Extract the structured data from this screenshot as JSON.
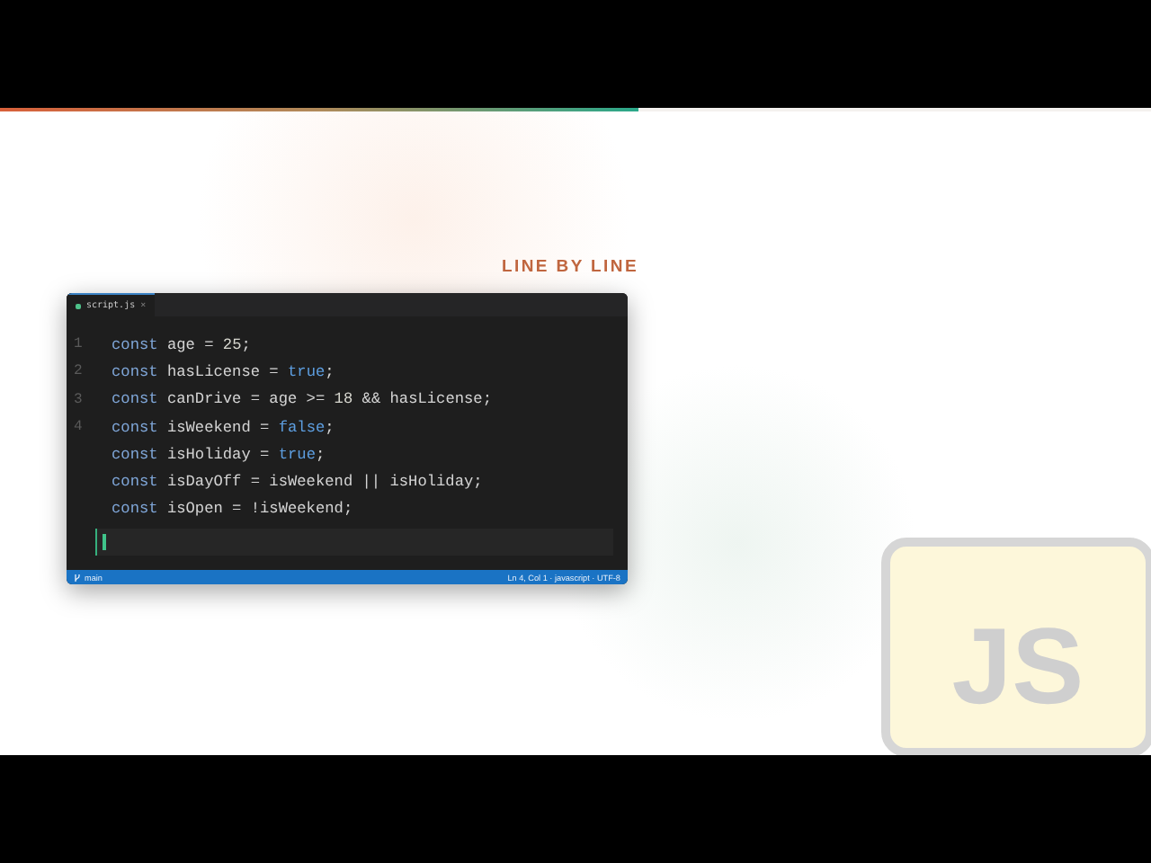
{
  "progress": {
    "level": 0.555
  },
  "heading": "LINE BY LINE",
  "editor": {
    "tab": {
      "label": "script.js",
      "close": "×",
      "selected": true
    },
    "lines": [
      {
        "number": "1",
        "tokens": [
          {
            "kind": "keyword",
            "text": "const"
          },
          {
            "kind": "plain",
            "text": " age = "
          },
          {
            "kind": "number",
            "text": "25"
          },
          {
            "kind": "plain",
            "text": ";"
          }
        ]
      },
      {
        "number": "2",
        "tokens": [
          {
            "kind": "keyword",
            "text": "const"
          },
          {
            "kind": "plain",
            "text": " hasLicense = "
          },
          {
            "kind": "literal",
            "text": "true"
          },
          {
            "kind": "plain",
            "text": ";"
          }
        ]
      },
      {
        "number": "3",
        "tokens": [
          {
            "kind": "keyword",
            "text": "const"
          },
          {
            "kind": "plain",
            "text": " canDrive = age >= "
          },
          {
            "kind": "number",
            "text": "18"
          },
          {
            "kind": "plain",
            "text": " && hasLicense;"
          }
        ]
      },
      {
        "number": "4",
        "tokens": [
          {
            "kind": "keyword",
            "text": "const"
          },
          {
            "kind": "plain",
            "text": " isWeekend = "
          },
          {
            "kind": "literal",
            "text": "false"
          },
          {
            "kind": "plain",
            "text": ";"
          }
        ]
      },
      {
        "tokens": [
          {
            "kind": "keyword",
            "text": "const"
          },
          {
            "kind": "plain",
            "text": " isHoliday = "
          },
          {
            "kind": "literal",
            "text": "true"
          },
          {
            "kind": "plain",
            "text": ";"
          }
        ]
      },
      {
        "tokens": [
          {
            "kind": "keyword",
            "text": "const"
          },
          {
            "kind": "plain",
            "text": " isDayOff = isWeekend || isHoliday;"
          }
        ]
      },
      {
        "tokens": [
          {
            "kind": "keyword",
            "text": "const"
          },
          {
            "kind": "plain",
            "text": " isOpen = !isWeekend;"
          }
        ]
      }
    ],
    "status": {
      "branch": "main",
      "position": "Ln 4, Col 1 · javascript · UTF-8"
    }
  },
  "badge": "JS"
}
